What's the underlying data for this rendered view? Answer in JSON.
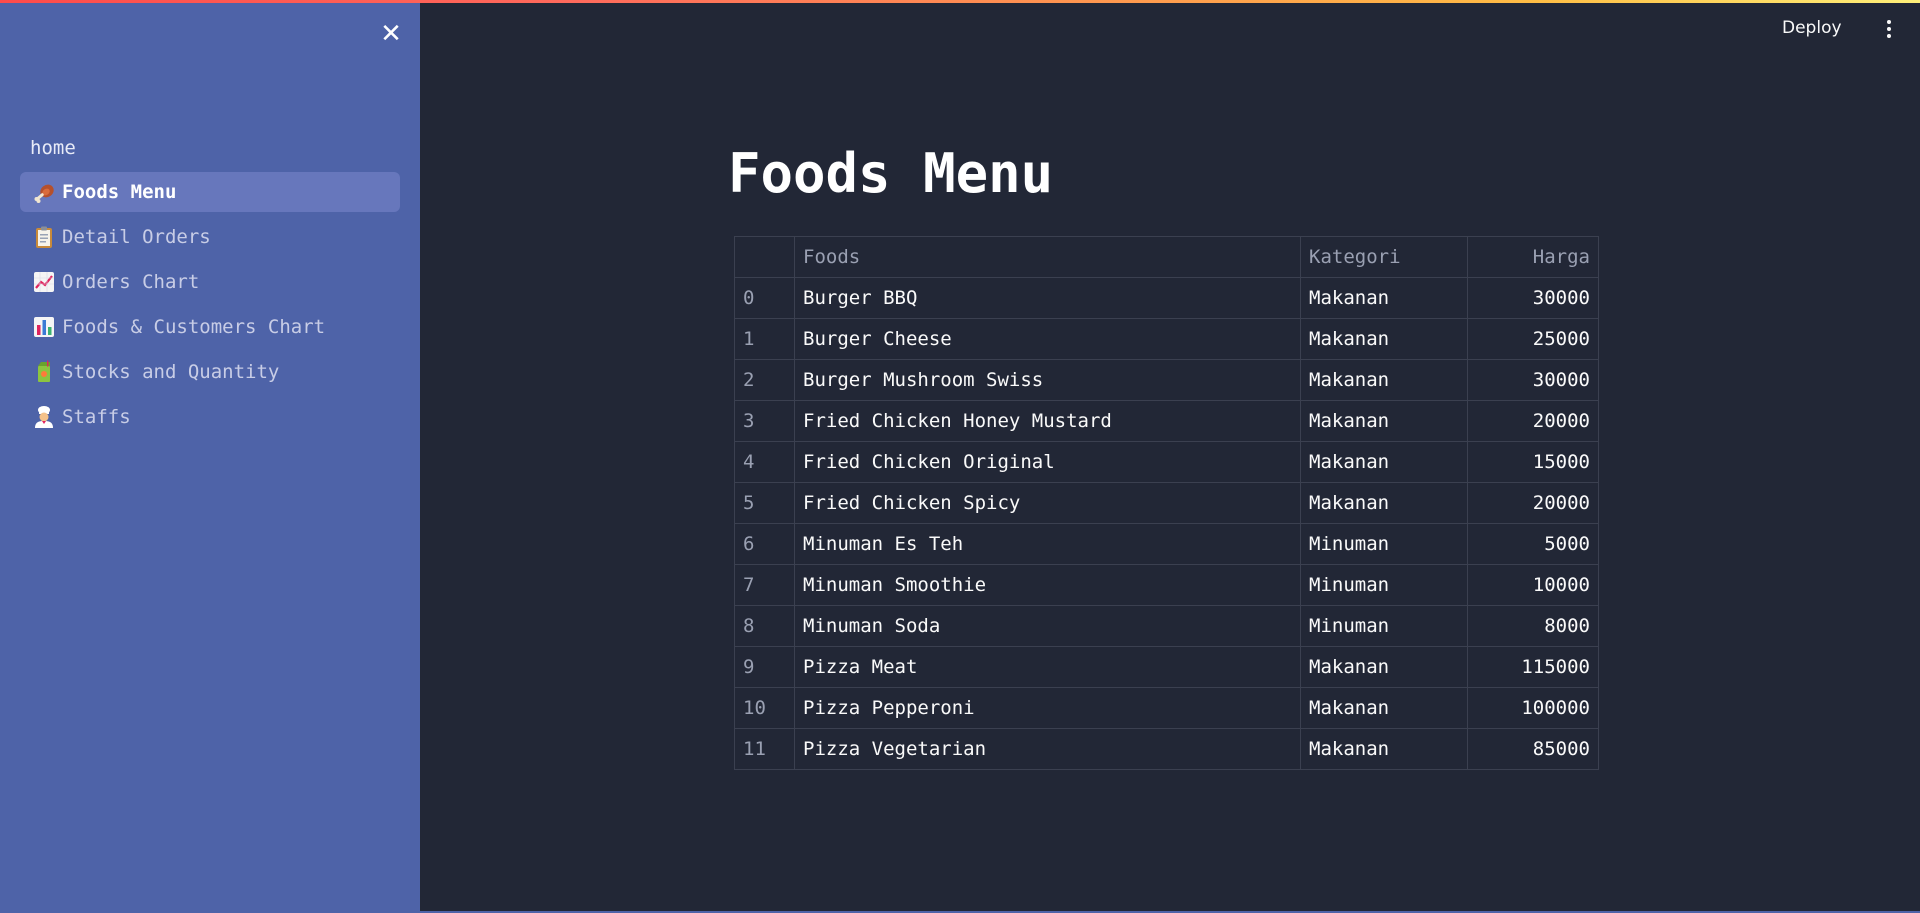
{
  "sidebar": {
    "home_label": "home",
    "items": [
      {
        "label": "Foods Menu",
        "icon": "meat-on-bone-icon",
        "active": true
      },
      {
        "label": "Detail Orders",
        "icon": "clipboard-icon",
        "active": false
      },
      {
        "label": "Orders Chart",
        "icon": "chart-increasing-icon",
        "active": false
      },
      {
        "label": "Foods & Customers Chart",
        "icon": "bar-chart-icon",
        "active": false
      },
      {
        "label": "Stocks and Quantity",
        "icon": "juice-box-icon",
        "active": false
      },
      {
        "label": "Staffs",
        "icon": "cook-icon",
        "active": false
      }
    ],
    "close_icon": "close-icon"
  },
  "header": {
    "deploy_label": "Deploy",
    "menu_icon": "kebab-menu-icon"
  },
  "main": {
    "title": "Foods Menu",
    "table": {
      "columns": [
        "",
        "Foods",
        "Kategori",
        "Harga"
      ],
      "rows": [
        [
          "0",
          "Burger BBQ",
          "Makanan",
          "30000"
        ],
        [
          "1",
          "Burger Cheese",
          "Makanan",
          "25000"
        ],
        [
          "2",
          "Burger Mushroom Swiss",
          "Makanan",
          "30000"
        ],
        [
          "3",
          "Fried Chicken Honey Mustard",
          "Makanan",
          "20000"
        ],
        [
          "4",
          "Fried Chicken Original",
          "Makanan",
          "15000"
        ],
        [
          "5",
          "Fried Chicken Spicy",
          "Makanan",
          "20000"
        ],
        [
          "6",
          "Minuman Es Teh",
          "Minuman",
          "5000"
        ],
        [
          "7",
          "Minuman Smoothie",
          "Minuman",
          "10000"
        ],
        [
          "8",
          "Minuman Soda",
          "Minuman",
          "8000"
        ],
        [
          "9",
          "Pizza Meat",
          "Makanan",
          "115000"
        ],
        [
          "10",
          "Pizza Pepperoni",
          "Makanan",
          "100000"
        ],
        [
          "11",
          "Pizza Vegetarian",
          "Makanan",
          "85000"
        ]
      ]
    }
  },
  "colors": {
    "sidebar_bg": "#4e63a8",
    "main_bg": "#222736",
    "active_item_bg": "#6777bc",
    "accent_gradient_start": "#ff4b4b",
    "accent_gradient_end": "#fff07a"
  }
}
